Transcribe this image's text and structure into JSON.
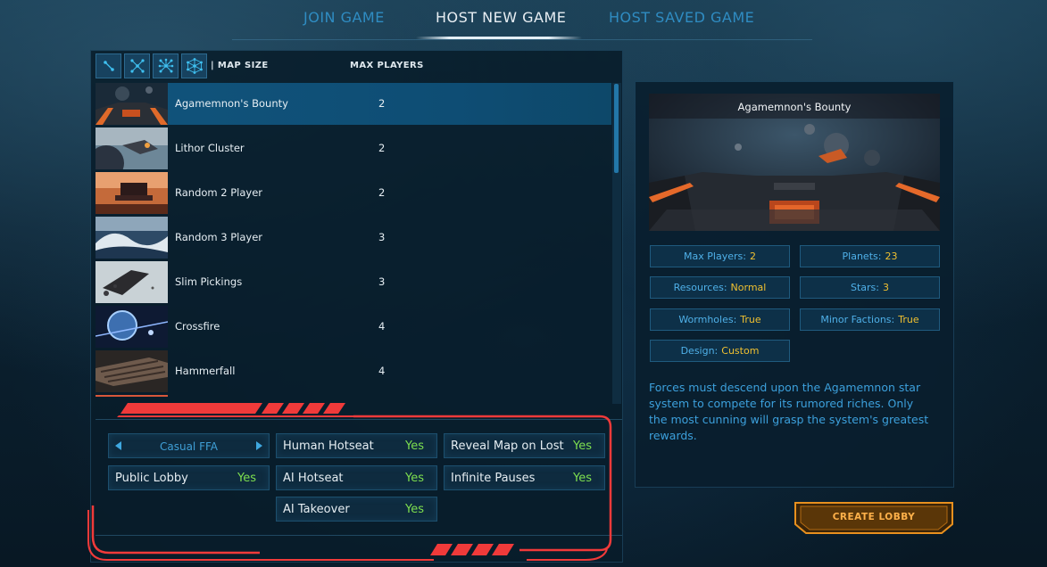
{
  "tabs": [
    {
      "label": "JOIN GAME"
    },
    {
      "label": "HOST NEW GAME"
    },
    {
      "label": "HOST SAVED GAME"
    }
  ],
  "list_header": {
    "map_size": "| MAP SIZE",
    "max_players": "MAX PLAYERS"
  },
  "filter_icons": [
    "small-map-icon",
    "medium-map-icon",
    "large-map-icon",
    "huge-map-icon"
  ],
  "maps": [
    {
      "name": "Agamemnon's Bounty",
      "players": "2",
      "selected": true
    },
    {
      "name": "Lithor Cluster",
      "players": "2"
    },
    {
      "name": "Random 2 Player",
      "players": "2"
    },
    {
      "name": "Random 3 Player",
      "players": "3"
    },
    {
      "name": "Slim Pickings",
      "players": "3"
    },
    {
      "name": "Crossfire",
      "players": "4"
    },
    {
      "name": "Hammerfall",
      "players": "4"
    }
  ],
  "settings": {
    "mode": "Casual FFA",
    "public_lobby": {
      "label": "Public Lobby",
      "value": "Yes"
    },
    "human_hotseat": {
      "label": "Human Hotseat",
      "value": "Yes"
    },
    "ai_hotseat": {
      "label": "AI Hotseat",
      "value": "Yes"
    },
    "ai_takeover": {
      "label": "AI Takeover",
      "value": "Yes"
    },
    "reveal_map": {
      "label": "Reveal Map on Lost",
      "value": "Yes"
    },
    "infinite_pauses": {
      "label": "Infinite Pauses",
      "value": "Yes"
    }
  },
  "preview": {
    "title": "Agamemnon's Bounty",
    "stats": {
      "max_players": {
        "label": "Max Players:",
        "value": "2"
      },
      "planets": {
        "label": "Planets:",
        "value": "23"
      },
      "resources": {
        "label": "Resources:",
        "value": "Normal"
      },
      "stars": {
        "label": "Stars:",
        "value": "3"
      },
      "wormholes": {
        "label": "Wormholes:",
        "value": "True"
      },
      "minor_factions": {
        "label": "Minor Factions:",
        "value": "True"
      },
      "design": {
        "label": "Design:",
        "value": "Custom"
      }
    },
    "description": "Forces must descend upon the Agamemnon star system to compete for its rumored riches. Only the most cunning will grasp the system's greatest rewards."
  },
  "create_button": "CREATE LOBBY",
  "colors": {
    "accent_blue": "#2f8cc2",
    "value_green": "#7ddf4f",
    "value_gold": "#f0c030",
    "highlight_red": "#f03a3a",
    "button_orange": "#ffb14a"
  }
}
